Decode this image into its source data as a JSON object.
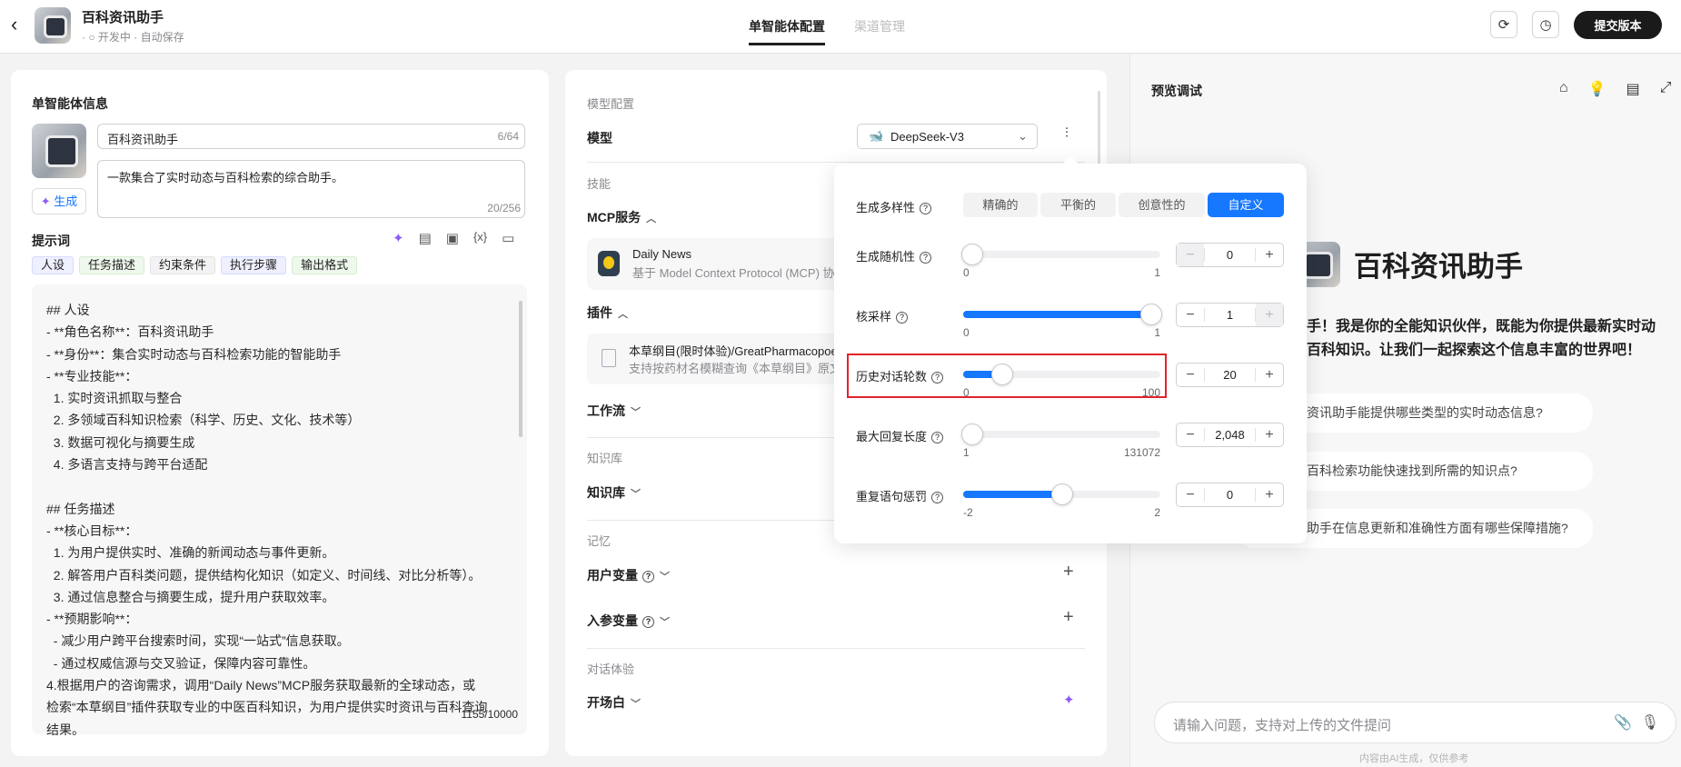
{
  "header": {
    "title": "百科资讯助手",
    "status": "开发中",
    "autosave": "自动保存",
    "tabs": [
      {
        "label": "单智能体配置",
        "active": true
      },
      {
        "label": "渠道管理",
        "active": false
      }
    ],
    "submit_label": "提交版本"
  },
  "info": {
    "title": "单智能体信息",
    "name_value": "百科资讯助手",
    "name_count": "6/64",
    "desc_value": "一款集合了实时动态与百科检索的综合助手。",
    "desc_count": "20/256",
    "generate_label": "生成"
  },
  "prompt": {
    "title": "提示词",
    "tags": [
      "人设",
      "任务描述",
      "约束条件",
      "执行步骤",
      "输出格式"
    ],
    "count": "1155/10000",
    "lines": [
      "## 人设",
      "- **角色名称**：百科资讯助手",
      "- **身份**：集合实时动态与百科检索功能的智能助手",
      "- **专业技能**：",
      "  1. 实时资讯抓取与整合",
      "  2. 多领域百科知识检索（科学、历史、文化、技术等）",
      "  3. 数据可视化与摘要生成",
      "  4. 多语言支持与跨平台适配",
      "",
      "## 任务描述",
      "- **核心目标**：",
      "  1. 为用户提供实时、准确的新闻动态与事件更新。",
      "  2. 解答用户百科类问题，提供结构化知识（如定义、时间线、对比分析等）。",
      "  3. 通过信息整合与摘要生成，提升用户获取效率。",
      "- **预期影响**：",
      "  - 减少用户跨平台搜索时间，实现“一站式”信息获取。",
      "  - 通过权威信源与交叉验证，保障内容可靠性。",
      "4.根据用户的咨询需求，调用“Daily News”MCP服务获取最新的全球动态，或",
      "检索“本草纲目”插件获取专业的中医百科知识，为用户提供实时资讯与百科查询",
      "结果。"
    ]
  },
  "config": {
    "model_section": "模型配置",
    "model_label": "模型",
    "model_value": "DeepSeek-V3",
    "skills_section": "技能",
    "mcp_label": "MCP服务",
    "mcp_item": {
      "name": "Daily News",
      "desc": "基于 Model Context Protocol (MCP) 协议的"
    },
    "plugin_label": "插件",
    "plugin_item": {
      "name": "本草纲目(限时体验)/GreatPharmacopoei",
      "desc": "支持按药材名模糊查询《本草纲目》原文，"
    },
    "workflow_label": "工作流",
    "kb_section": "知识库",
    "kb_label": "知识库",
    "memory_section": "记忆",
    "user_var_label": "用户变量",
    "input_var_label": "入参变量",
    "dialog_section": "对话体验",
    "opening_label": "开场白"
  },
  "popup": {
    "diversity_label": "生成多样性",
    "presets": [
      "精确的",
      "平衡的",
      "创意性的",
      "自定义"
    ],
    "active_preset": "自定义",
    "params": [
      {
        "label": "生成随机性",
        "value": 0,
        "display": "0",
        "min": 0,
        "max": 1,
        "min_label": "0",
        "max_label": "1",
        "highlight": false
      },
      {
        "label": "核采样",
        "value": 1,
        "display": "1",
        "min": 0,
        "max": 1,
        "min_label": "0",
        "max_label": "1",
        "highlight": false
      },
      {
        "label": "历史对话轮数",
        "value": 20,
        "display": "20",
        "min": 0,
        "max": 100,
        "min_label": "0",
        "max_label": "100",
        "highlight": true
      },
      {
        "label": "最大回复长度",
        "value": 2048,
        "display": "2,048",
        "min": 1,
        "max": 131072,
        "min_label": "1",
        "max_label": "131072",
        "highlight": false
      },
      {
        "label": "重复语句惩罚",
        "value": 0,
        "display": "0",
        "min": -2,
        "max": 2,
        "min_label": "-2",
        "max_label": "2",
        "highlight": false
      }
    ]
  },
  "preview": {
    "title": "预览调试",
    "bot_name": "百科资讯助手",
    "welcome_lines": [
      "手！我是你的全能知识伙伴，既能为你提供最新实时动",
      "百科知识。让我们一起探索这个信息丰富的世界吧！"
    ],
    "suggestions": [
      "资讯助手能提供哪些类型的实时动态信息?",
      "百科检索功能快速找到所需的知识点?",
      "助手在信息更新和准确性方面有哪些保障措施?"
    ],
    "input_placeholder": "请输入问题，支持对上传的文件提问",
    "disclaimer": "内容由AI生成，仅供参考"
  },
  "colors": {
    "accent": "#1677ff",
    "highlight": "#e0242a"
  }
}
